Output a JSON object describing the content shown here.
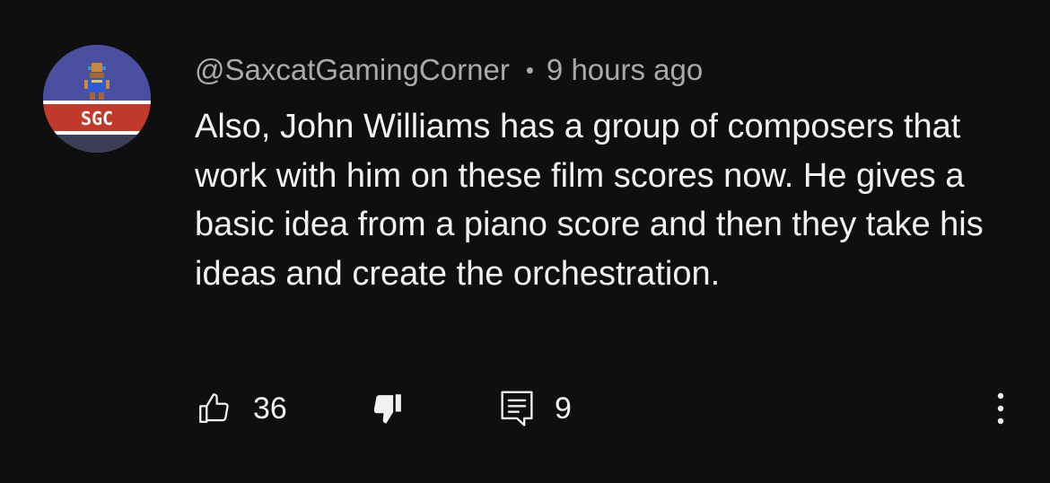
{
  "comment": {
    "author": "@SaxcatGamingCorner",
    "separator": "•",
    "timestamp": "9 hours ago",
    "text": "Also, John Williams has a group of composers that work with him on these film scores now. He gives a basic idea from a piano score and then they take his ideas and create the orchestration.",
    "avatar": {
      "badge_text": "SGC",
      "colors": {
        "background": "#4a4fa0",
        "band": "#c0392b"
      }
    }
  },
  "actions": {
    "like_count": "36",
    "reply_count": "9",
    "icons": [
      "thumbs-up-icon",
      "thumbs-down-icon",
      "reply-icon",
      "more-vertical-icon"
    ]
  },
  "colors": {
    "background": "#0f0f0f",
    "text_primary": "#f1f1f1",
    "text_secondary": "#aaaaaa"
  }
}
